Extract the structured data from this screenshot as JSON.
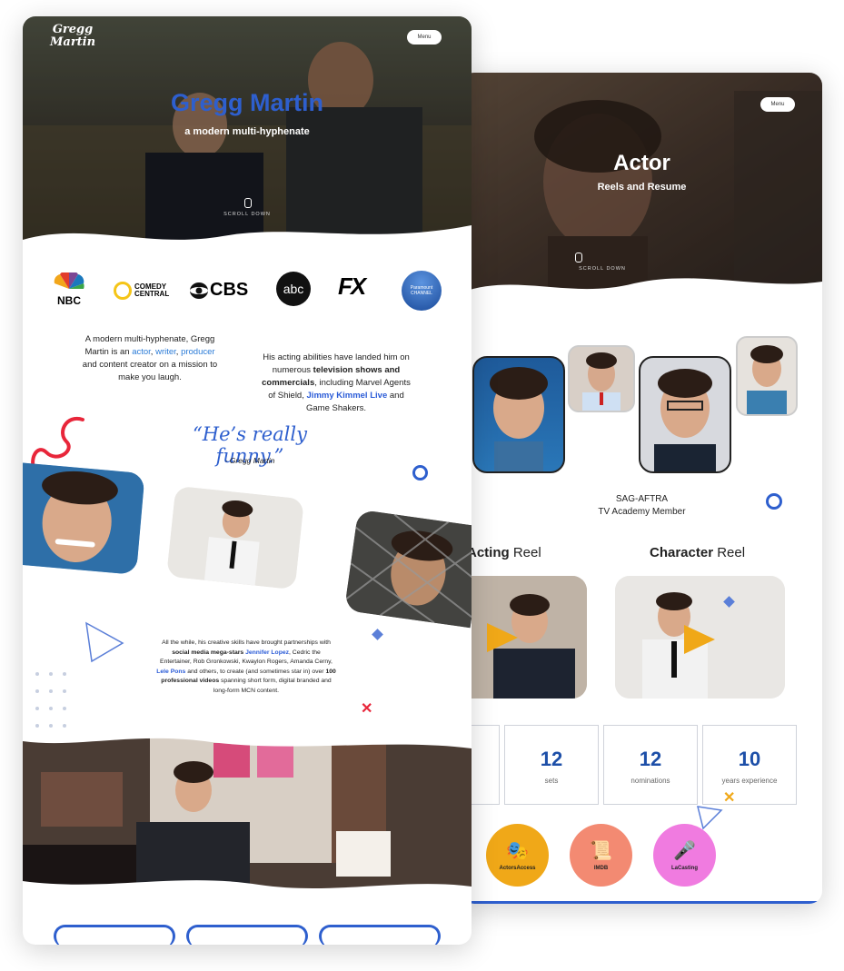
{
  "back": {
    "menu_label": "Menu",
    "hero_title": "Actor",
    "hero_subtitle": "Reels and Resume",
    "scroll_label": "SCROLL DOWN",
    "sag_line1": "SAG-AFTRA",
    "sag_line2": "TV Academy Member",
    "reel_acting_bold": "Acting",
    "reel_acting_rest": " Reel",
    "reel_character_bold": "Character",
    "reel_character_rest": " Reel",
    "stats": [
      {
        "num": "12",
        "label": "sets"
      },
      {
        "num": "12",
        "label": "nominations"
      },
      {
        "num": "10",
        "label": "years experience"
      }
    ],
    "links": [
      {
        "label": "ActorsAccess",
        "color": "#f0a818"
      },
      {
        "label": "IMDB",
        "color": "#f38a72"
      },
      {
        "label": "LaCasting",
        "color": "#f07be0"
      }
    ]
  },
  "front": {
    "logo_line1": "Gregg",
    "logo_line2": "Martin",
    "menu_label": "Menu",
    "hero_title": "Gregg Martin",
    "hero_subtitle": "a modern multi-hyphenate",
    "scroll_label": "SCROLL DOWN",
    "networks": [
      "NBC",
      "COMEDY CENTRAL",
      "CBS",
      "abc",
      "FX",
      "Paramount CHANNEL"
    ],
    "intro": {
      "p1": "A modern multi-hyphenate, Gregg Martin is an",
      "actor": "actor",
      "writer": "writer",
      "producer": "producer",
      "p2": "and content creator on a mission to make you laugh."
    },
    "acting": {
      "p1": "His acting abilities have landed him on numerous",
      "bold1": "television shows and commercials",
      "p2": ", including Marvel Agents of Shield,",
      "link": "Jimmy Kimmel Live",
      "p3": "and Game Shakers."
    },
    "quote": "“He’s really funny.”",
    "quote_author": "- Gregg Martin",
    "partners": {
      "p1": "All the while, his creative skills have brought partnerships with",
      "bold1": "social media mega-stars",
      "link1": "Jennifer Lopez",
      "p2": ", Cedric the Entertainer, Rob Gronkowski, Kwaylon Rogers, Amanda Cerny,",
      "link2": "Lele Pons",
      "p3": "and others, to create (and sometimes star in) over",
      "bold2": "100 professional videos",
      "p4": "spanning short form, digital branded and long-form MCN content."
    }
  },
  "colors": {
    "accent_blue": "#2e5fce",
    "red": "#e8263a",
    "orange": "#f0a818"
  }
}
